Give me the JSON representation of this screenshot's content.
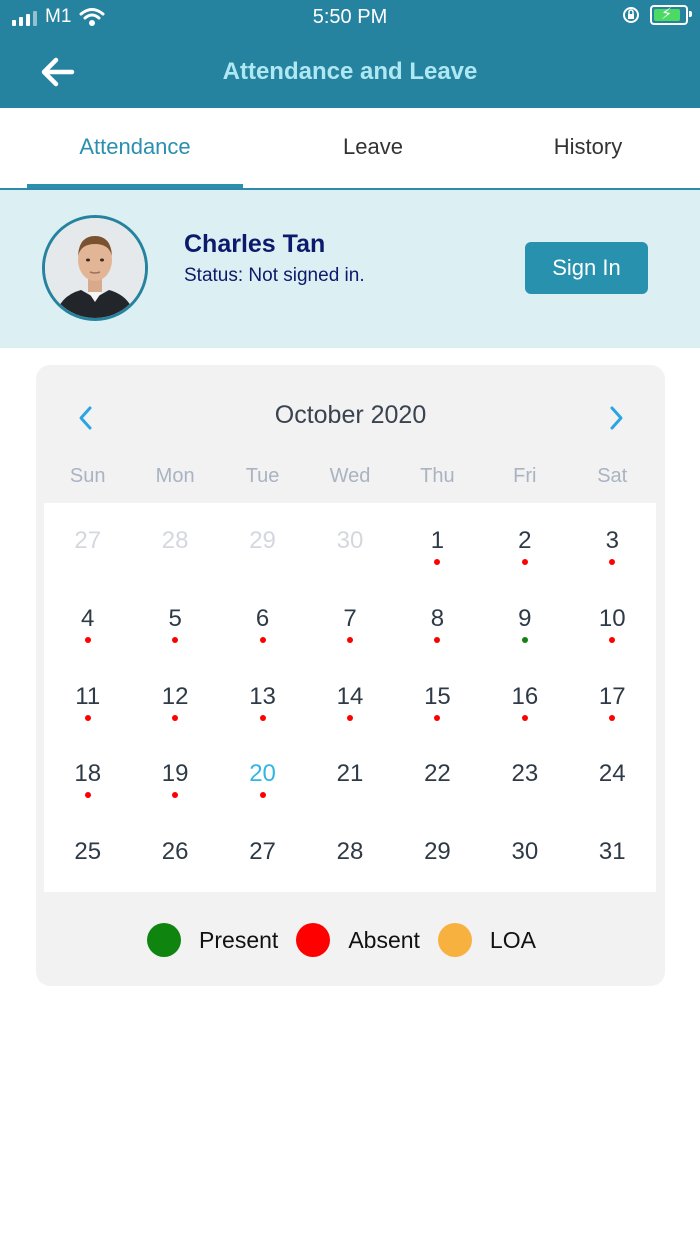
{
  "status_bar": {
    "carrier": "M1",
    "time": "5:50 PM"
  },
  "header": {
    "title": "Attendance and Leave"
  },
  "tabs": [
    {
      "label": "Attendance",
      "active": true
    },
    {
      "label": "Leave",
      "active": false
    },
    {
      "label": "History",
      "active": false
    }
  ],
  "profile": {
    "name": "Charles Tan",
    "status": "Status: Not signed in.",
    "sign_in_label": "Sign In"
  },
  "calendar": {
    "month_label": "October 2020",
    "weekdays": [
      "Sun",
      "Mon",
      "Tue",
      "Wed",
      "Thu",
      "Fri",
      "Sat"
    ],
    "days": [
      {
        "d": "27",
        "muted": true
      },
      {
        "d": "28",
        "muted": true
      },
      {
        "d": "29",
        "muted": true
      },
      {
        "d": "30",
        "muted": true
      },
      {
        "d": "1",
        "mark": "absent"
      },
      {
        "d": "2",
        "mark": "absent"
      },
      {
        "d": "3",
        "mark": "absent"
      },
      {
        "d": "4",
        "mark": "absent"
      },
      {
        "d": "5",
        "mark": "absent"
      },
      {
        "d": "6",
        "mark": "absent"
      },
      {
        "d": "7",
        "mark": "absent"
      },
      {
        "d": "8",
        "mark": "absent"
      },
      {
        "d": "9",
        "mark": "present"
      },
      {
        "d": "10",
        "mark": "absent"
      },
      {
        "d": "11",
        "mark": "absent"
      },
      {
        "d": "12",
        "mark": "absent"
      },
      {
        "d": "13",
        "mark": "absent"
      },
      {
        "d": "14",
        "mark": "absent"
      },
      {
        "d": "15",
        "mark": "absent"
      },
      {
        "d": "16",
        "mark": "absent"
      },
      {
        "d": "17",
        "mark": "absent"
      },
      {
        "d": "18",
        "mark": "absent"
      },
      {
        "d": "19",
        "mark": "absent"
      },
      {
        "d": "20",
        "mark": "absent",
        "today": true
      },
      {
        "d": "21"
      },
      {
        "d": "22"
      },
      {
        "d": "23"
      },
      {
        "d": "24"
      },
      {
        "d": "25"
      },
      {
        "d": "26"
      },
      {
        "d": "27"
      },
      {
        "d": "28"
      },
      {
        "d": "29"
      },
      {
        "d": "30"
      },
      {
        "d": "31"
      }
    ]
  },
  "legend": [
    {
      "label": "Present",
      "color": "#0f840f"
    },
    {
      "label": "Absent",
      "color": "#ff0000"
    },
    {
      "label": "LOA",
      "color": "#f7b13f"
    }
  ],
  "colors": {
    "header": "#2683a0",
    "accent": "#2b8fb0",
    "today": "#33b5e5"
  },
  "icons": {
    "back": "arrow-left-icon",
    "prev": "chevron-left-icon",
    "next": "chevron-right-icon"
  }
}
